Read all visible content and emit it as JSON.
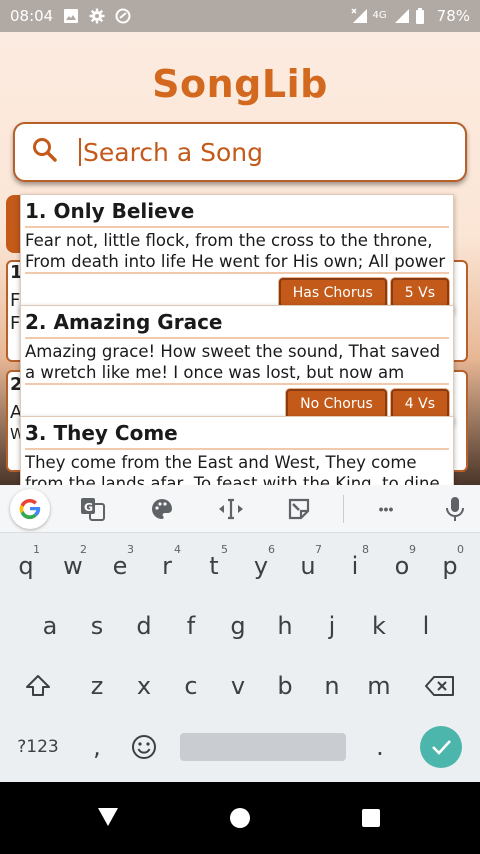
{
  "status_bar": {
    "time": "08:04",
    "network_label": "4G",
    "battery_percent": "78%",
    "icons": [
      "image-icon",
      "settings-icon",
      "at-icon",
      "signal-x-icon",
      "signal-icon",
      "battery-icon"
    ]
  },
  "app": {
    "title": "SongLib",
    "search": {
      "placeholder": "Search a Song",
      "icon": "search-icon"
    },
    "ghost_letters": [
      "1",
      "F",
      "F",
      "2",
      "A",
      "W"
    ],
    "songs": [
      {
        "title": "1. Only Believe",
        "lyrics": "Fear not, little flock, from the cross to the throne, From death into life He went for His own; All power",
        "chorus": "Has Chorus",
        "verses": "5 Vs"
      },
      {
        "title": "2. Amazing Grace",
        "lyrics": "Amazing grace! How sweet the sound, That saved a wretch like me! I once was lost, but now am found,",
        "chorus": "No Chorus",
        "verses": "4 Vs"
      },
      {
        "title": "3. They Come",
        "lyrics": "They come from the East and West, They come from the lands afar, To feast with the King, to dine as His",
        "chorus": "",
        "verses": ""
      }
    ],
    "colors": {
      "accent": "#c35a1a",
      "title": "#d2691e"
    }
  },
  "keyboard": {
    "toolbar_icons": [
      "google-icon",
      "translate-icon",
      "palette-icon",
      "text-cursor-icon",
      "sticker-icon",
      "more-icon",
      "mic-icon"
    ],
    "google_letter": "G",
    "more": "•••",
    "row1": [
      {
        "k": "q",
        "h": "1"
      },
      {
        "k": "w",
        "h": "2"
      },
      {
        "k": "e",
        "h": "3"
      },
      {
        "k": "r",
        "h": "4"
      },
      {
        "k": "t",
        "h": "5"
      },
      {
        "k": "y",
        "h": "6"
      },
      {
        "k": "u",
        "h": "7"
      },
      {
        "k": "i",
        "h": "8"
      },
      {
        "k": "o",
        "h": "9"
      },
      {
        "k": "p",
        "h": "0"
      }
    ],
    "row2": [
      "a",
      "s",
      "d",
      "f",
      "g",
      "h",
      "j",
      "k",
      "l"
    ],
    "row3": [
      "z",
      "x",
      "c",
      "v",
      "b",
      "n",
      "m"
    ],
    "sym_label": "?123",
    "comma": ",",
    "period": ".",
    "emoji_icon": "emoji-icon",
    "shift_icon": "shift-icon",
    "backspace_icon": "backspace-icon",
    "enter_icon": "check-icon"
  },
  "nav_bar": {
    "icons": [
      "back-icon",
      "home-icon",
      "recents-icon"
    ]
  }
}
